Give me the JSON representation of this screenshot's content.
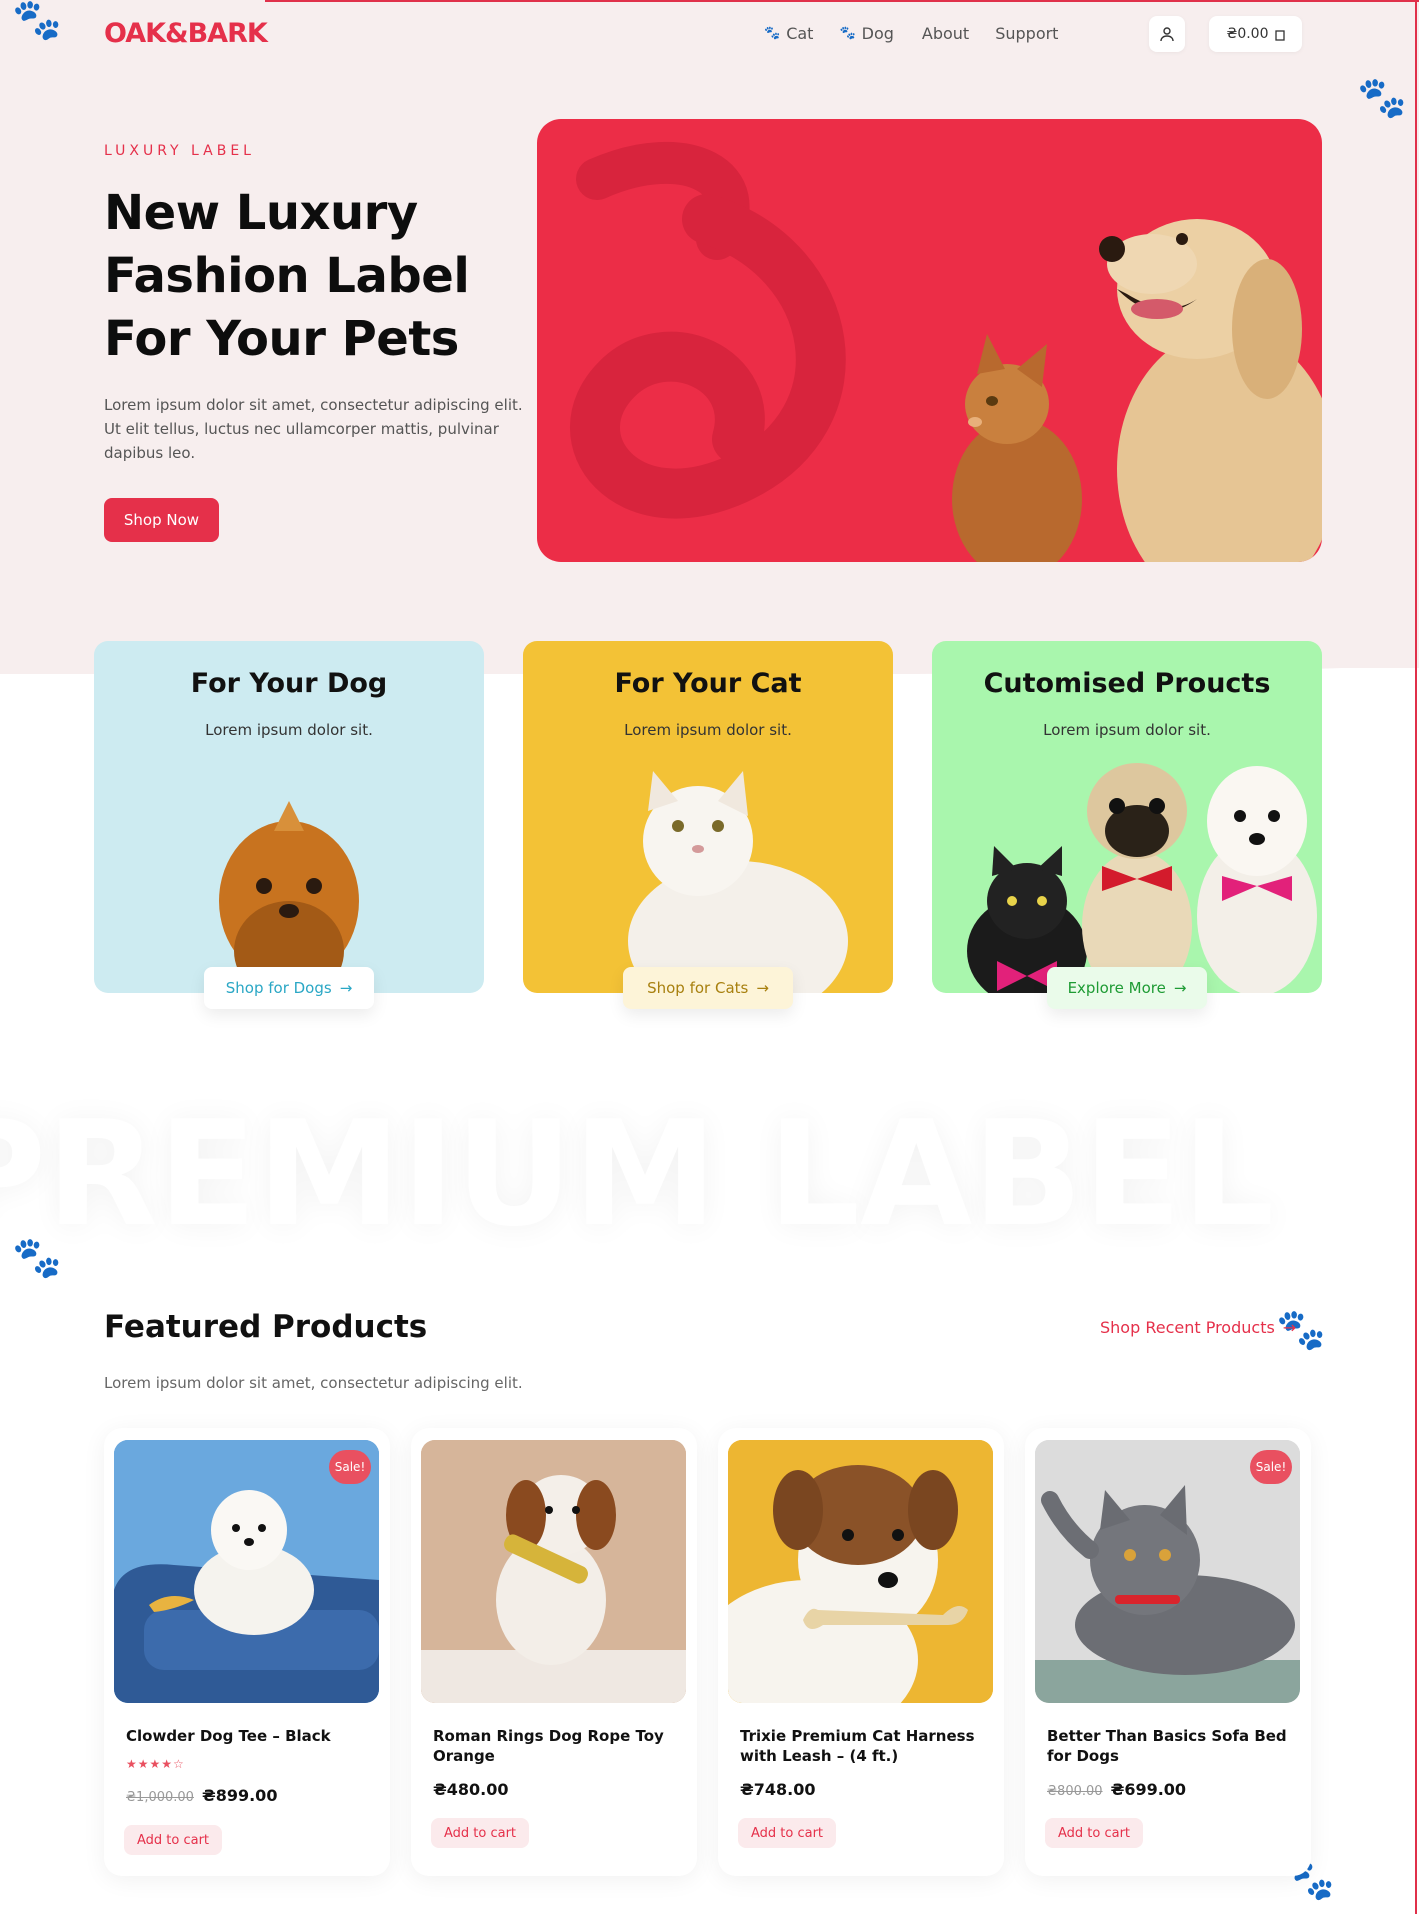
{
  "header": {
    "logo": "OAK&BARK",
    "nav": [
      {
        "label": "Cat",
        "icon": "paw-icon"
      },
      {
        "label": "Dog",
        "icon": "paw-icon"
      },
      {
        "label": "About"
      },
      {
        "label": "Support"
      }
    ],
    "cart_total": "₴0.00"
  },
  "hero": {
    "eyebrow": "LUXURY LABEL",
    "title": "New Luxury Fashion Label For Your Pets",
    "text": "Lorem ipsum dolor sit amet, consectetur adipiscing elit. Ut elit tellus, luctus nec ullamcorper mattis, pulvinar dapibus leo.",
    "cta": "Shop Now"
  },
  "categories": [
    {
      "title": "For Your Dog",
      "subtitle": "Lorem ipsum dolor sit.",
      "button": "Shop for Dogs",
      "bg": "#cdebf1",
      "accent": "#2aa7c5"
    },
    {
      "title": "For Your Cat",
      "subtitle": "Lorem ipsum dolor sit.",
      "button": "Shop for Cats",
      "bg": "#f3c236",
      "accent": "#b88708"
    },
    {
      "title": "Cutomised Proucts",
      "subtitle": "Lorem ipsum dolor sit.",
      "button": "Explore More",
      "bg": "#a9f6ad",
      "accent": "#1e9b34"
    }
  ],
  "watermark": "PREMIUM LABEL",
  "featured": {
    "title": "Featured Products",
    "subtitle": "Lorem ipsum dolor sit amet, consectetur adipiscing elit.",
    "link": "Shop Recent Products",
    "products": [
      {
        "name": "Clowder Dog Tee – Black",
        "sale": "Sale!",
        "rating": "★★★★☆",
        "old_price": "₴1,000.00",
        "price": "₴899.00",
        "button": "Add to cart"
      },
      {
        "name": "Roman Rings Dog Rope Toy Orange",
        "sale": "",
        "old_price": "",
        "price": "₴480.00",
        "button": "Add to cart"
      },
      {
        "name": "Trixie Premium Cat Harness with Leash – (4 ft.)",
        "sale": "",
        "old_price": "",
        "price": "₴748.00",
        "button": "Add to cart"
      },
      {
        "name": "Better Than Basics Sofa Bed for Dogs",
        "sale": "Sale!",
        "old_price": "₴800.00",
        "price": "₴699.00",
        "button": "Add to cart"
      }
    ]
  },
  "colors": {
    "brand": "#e5304a",
    "hero_bg": "#ec2d47",
    "page_tint": "#f7eeee"
  }
}
